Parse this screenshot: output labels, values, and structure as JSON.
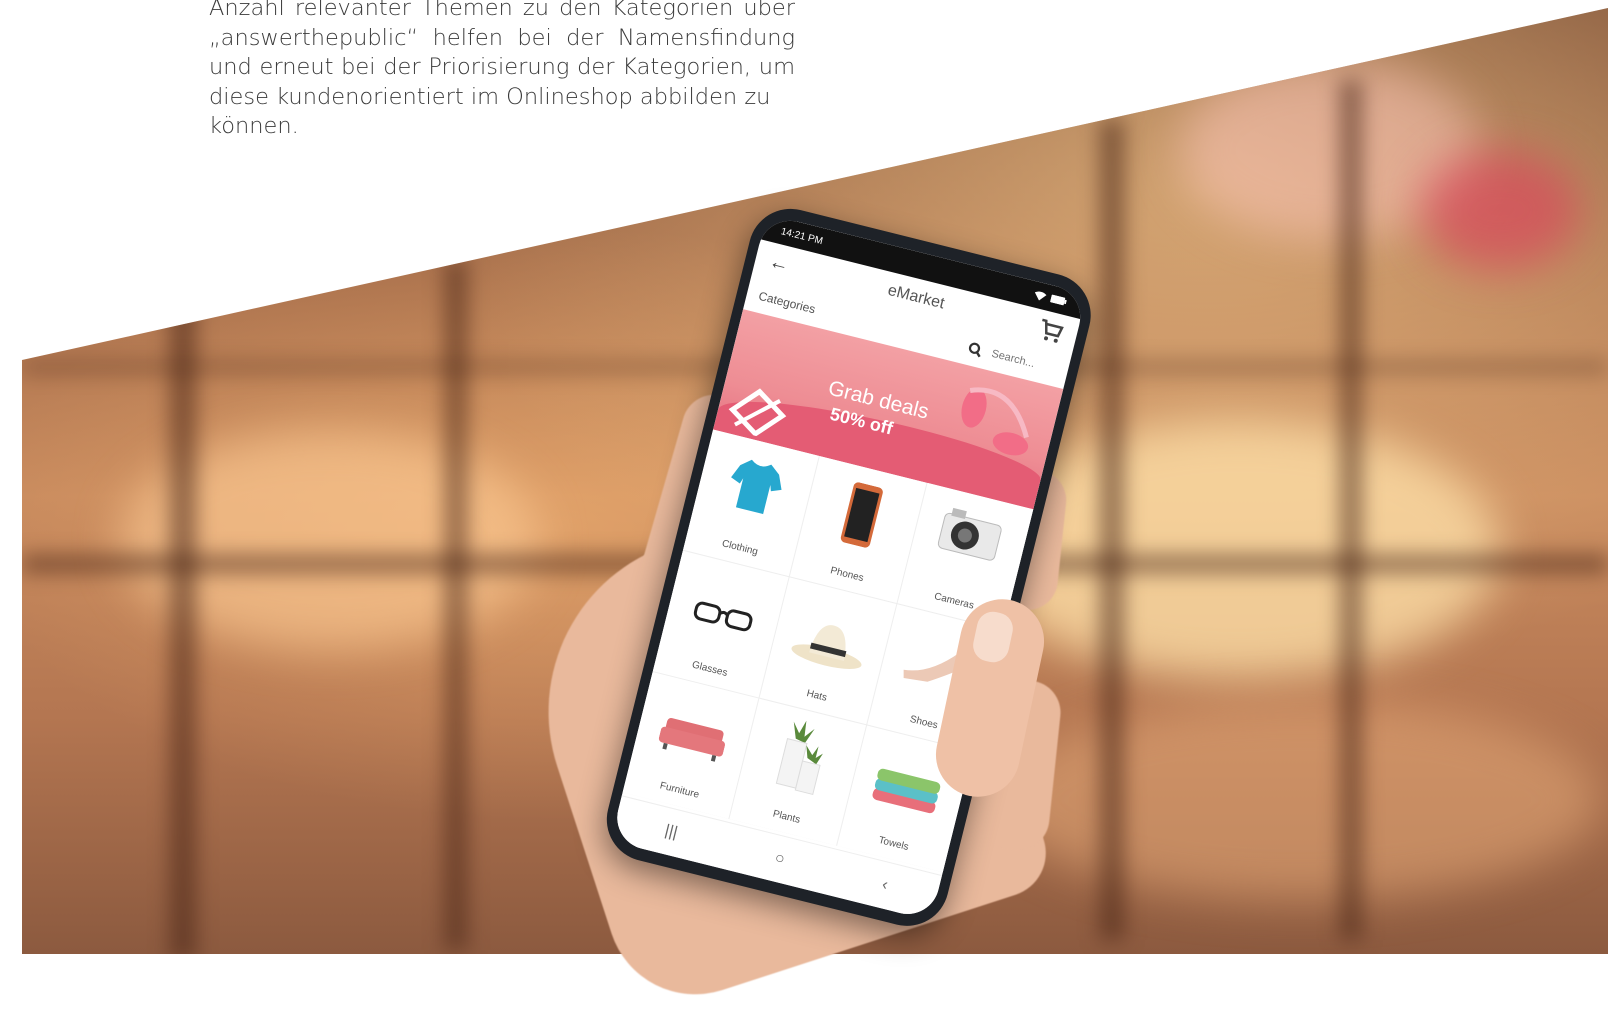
{
  "intro": {
    "line1": "Anzahl relevanter Themen zu den Kategorien über",
    "line2": "„answerthepublic“ helfen bei der Namensfindung",
    "line3": "und erneut bei der Priorisierung der Kategorien, um",
    "line4": "diese kundenorientiert im Onlineshop abbilden zu",
    "line5": "können."
  },
  "phone": {
    "status_time": "14:21 PM",
    "app_title": "eMarket",
    "section_label": "Categories",
    "search_placeholder": "Search...",
    "banner": {
      "title": "Grab deals",
      "discount": "50% off"
    },
    "categories": [
      {
        "label": "Clothing",
        "icon": "tshirt-icon"
      },
      {
        "label": "Phones",
        "icon": "phone-icon"
      },
      {
        "label": "Cameras",
        "icon": "camera-icon"
      },
      {
        "label": "Glasses",
        "icon": "glasses-icon"
      },
      {
        "label": "Hats",
        "icon": "hat-icon"
      },
      {
        "label": "Shoes",
        "icon": "shoe-icon"
      },
      {
        "label": "Furniture",
        "icon": "sofa-icon"
      },
      {
        "label": "Plants",
        "icon": "plant-icon"
      },
      {
        "label": "Towels",
        "icon": "towel-icon"
      }
    ],
    "nav": {
      "recent": "|||",
      "home": "○",
      "back": "‹"
    }
  },
  "colors": {
    "banner_pink": "#ee8d94",
    "banner_wave": "#e45c74",
    "phone_body": "#1e2228"
  }
}
